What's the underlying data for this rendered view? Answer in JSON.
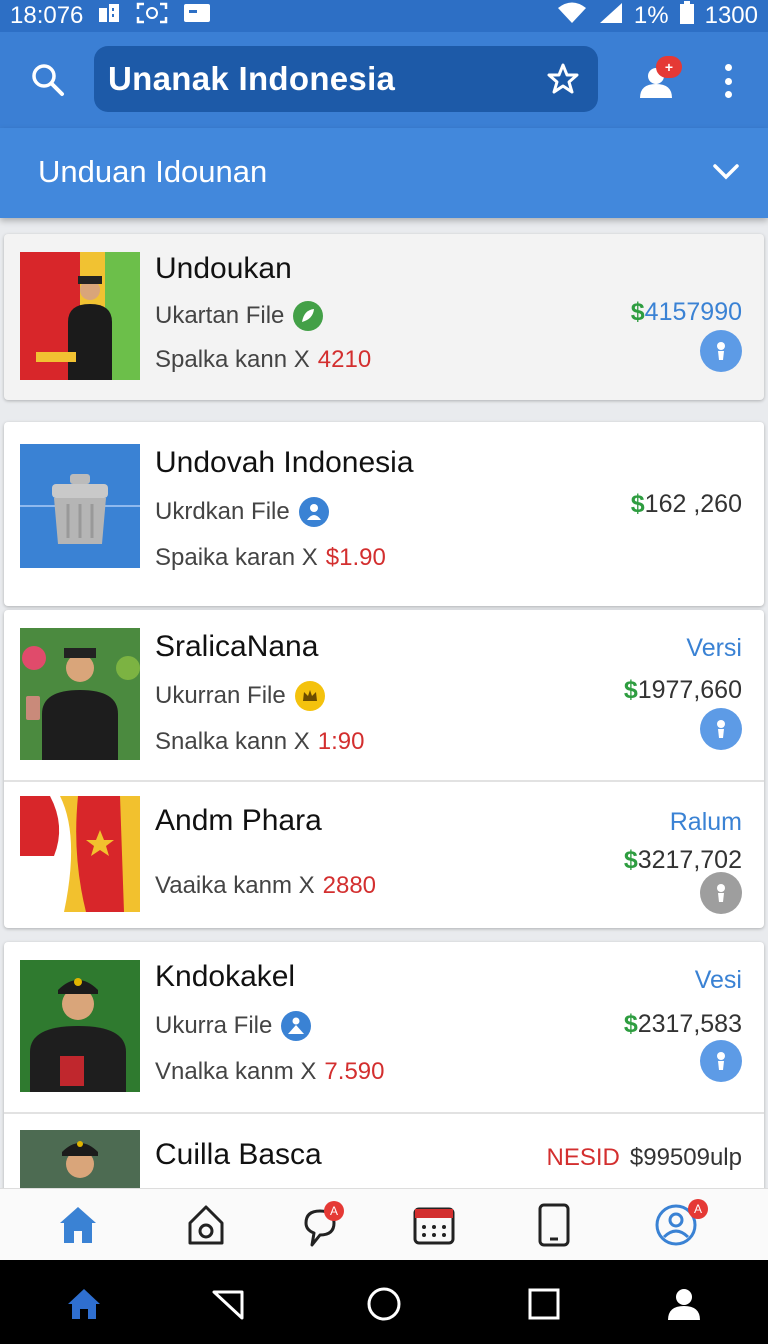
{
  "status": {
    "time": "18:076",
    "battery_text": "1%",
    "right_time": "1300"
  },
  "header": {
    "title": "Unanak Indonesia"
  },
  "subheader": {
    "title": "Unduan Idounan"
  },
  "items": [
    {
      "name": "Undoukan",
      "file_label": "Ukartan File",
      "line2_prefix": "Spalka kann X",
      "line2_value": "4210",
      "price_symbol": "$",
      "price": "4157990",
      "tag": ""
    },
    {
      "name": "Undovah Indonesia",
      "file_label": "Ukrdkan File",
      "line2_prefix": "Spaika karan X",
      "line2_value": "$1.90",
      "price_symbol": "$",
      "price": "162 ,260",
      "tag": ""
    },
    {
      "name": "SralicaNana",
      "file_label": "Ukurran File",
      "line2_prefix": "Snalka kann X",
      "line2_value": "1:90",
      "price_symbol": "$",
      "price": "1977,660",
      "tag": "Versi"
    },
    {
      "name": "Andm Phara",
      "file_label": "",
      "line2_prefix": "Vaaika kanm X",
      "line2_value": "2880",
      "price_symbol": "$",
      "price": "3217,702",
      "tag": "Ralum"
    },
    {
      "name": "Kndokakel",
      "file_label": "Ukurra File",
      "line2_prefix": "Vnalka kanm X",
      "line2_value": "7.590",
      "price_symbol": "$",
      "price": "2317,583",
      "tag": "Vesi"
    },
    {
      "name": "Cuilla Basca",
      "file_label": "",
      "line2_prefix": "",
      "line2_value": "",
      "price_symbol": "",
      "price": "$99509ulp",
      "tag": "NESID"
    }
  ],
  "bottom_nav": {
    "items": [
      "home-icon",
      "store-icon",
      "chat-icon",
      "calendar-icon",
      "phone-icon",
      "profile-icon"
    ],
    "chat_badge": "A",
    "profile_badge": "A"
  },
  "icons": {
    "search": "search-icon",
    "star": "star-icon",
    "alert": "user-alert-icon",
    "more": "more-vert-icon"
  },
  "colors": {
    "primary": "#3b7fd4",
    "green_price": "#2e9d40",
    "red_value": "#d32f2f"
  }
}
